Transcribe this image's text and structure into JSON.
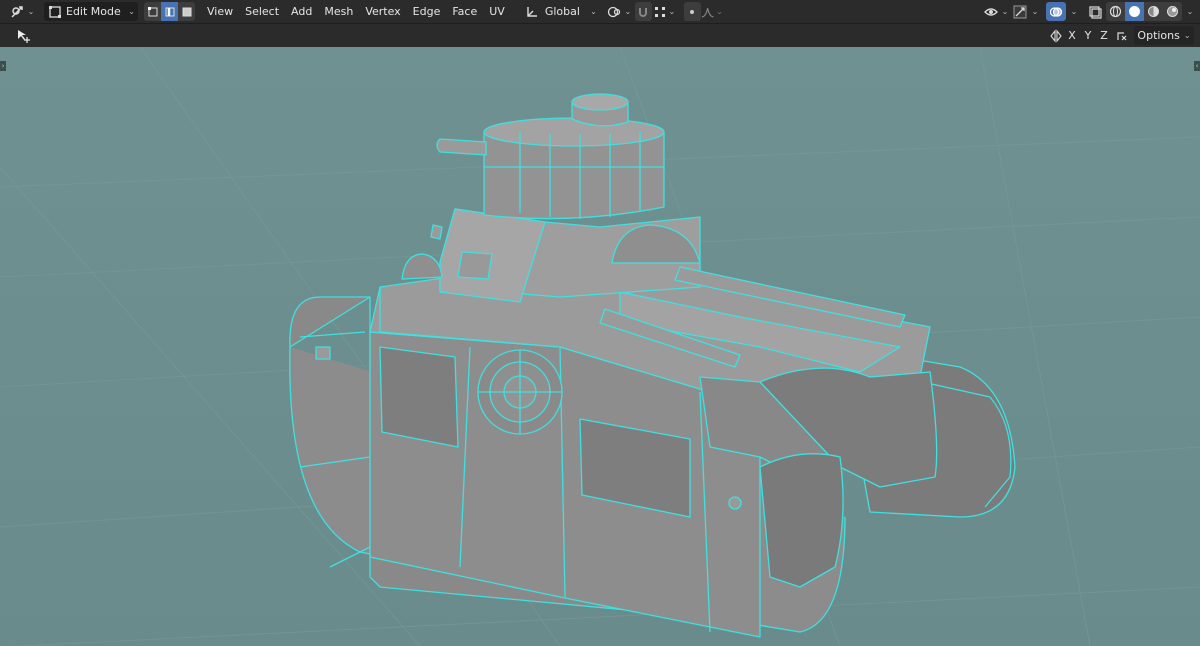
{
  "header": {
    "mode_label": "Edit Mode",
    "menus": [
      "View",
      "Select",
      "Add",
      "Mesh",
      "Vertex",
      "Edge",
      "Face",
      "UV"
    ],
    "transform_orientation": "Global"
  },
  "subheader": {
    "axes": [
      "X",
      "Y",
      "Z"
    ],
    "options_label": "Options"
  },
  "colors": {
    "header_bg": "#2b2b2b",
    "viewport_bg": "#6d8f8f",
    "active_blue": "#4772b3",
    "mesh_face": "#8c8c8c",
    "wire_cyan": "#3fe0e0"
  },
  "icons": {
    "editor_type": "editor-type-icon",
    "mode": "edit-mode-icon",
    "select_vertex": "vertex-select-icon",
    "select_edge": "edge-select-icon",
    "select_face": "face-select-icon",
    "orientation": "transform-orientation-icon",
    "pivot": "pivot-point-icon",
    "snap": "snap-icon",
    "snap_target": "snap-target-icon",
    "proportional": "proportional-edit-icon",
    "falloff": "falloff-icon",
    "visibility": "object-visibility-icon",
    "gizmo": "gizmo-icon",
    "overlay": "overlay-icon",
    "xray": "xray-icon",
    "wireframe": "wireframe-shading-icon",
    "solid": "solid-shading-icon",
    "material": "material-shading-icon",
    "rendered": "rendered-shading-icon",
    "tool": "tool-cursor-icon",
    "mirror": "mirror-icon",
    "autoclip": "auto-merge-icon"
  }
}
